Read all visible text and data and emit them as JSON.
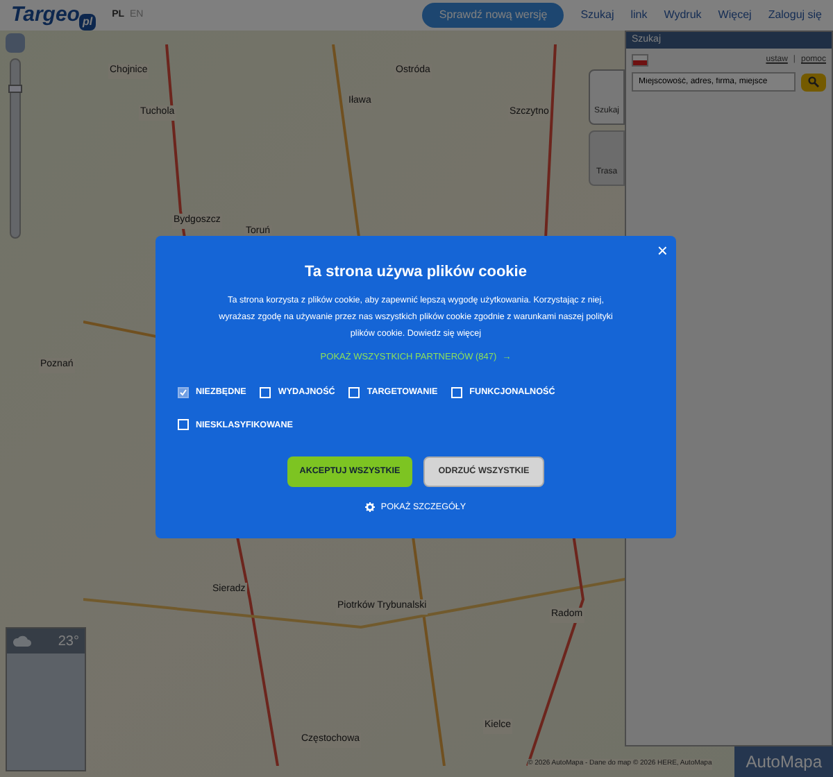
{
  "header": {
    "logo": "Targeo",
    "logo_suffix": "pl",
    "languages": [
      {
        "code": "PL",
        "selected": true
      },
      {
        "code": "EN",
        "selected": false
      }
    ],
    "new_version_button": "Sprawdź nową wersję",
    "nav": [
      "Szukaj",
      "link",
      "Wydruk",
      "Więcej",
      "Zaloguj się"
    ]
  },
  "map": {
    "cities": [
      {
        "name": "Chojnice"
      },
      {
        "name": "Tuchola"
      },
      {
        "name": "Iława"
      },
      {
        "name": "Ostróda"
      },
      {
        "name": "Szczytno"
      },
      {
        "name": "Bydgoszcz"
      },
      {
        "name": "Toruń"
      },
      {
        "name": "Poznań"
      },
      {
        "name": "Sieradz"
      },
      {
        "name": "Piotrków Trybunalski"
      },
      {
        "name": "Radom"
      },
      {
        "name": "Częstochowa"
      },
      {
        "name": "Kielce"
      }
    ],
    "zoom": {
      "level": 0.85
    },
    "attribution": "© 2026 AutoMapa - Dane do map © 2026 HERE, AutoMapa",
    "brand": "AutoMapa"
  },
  "weather": {
    "temperature": "23°"
  },
  "search_panel": {
    "title": "Szukaj",
    "links": [
      "ustaw",
      "pomoc"
    ],
    "link_separator": "|",
    "search_value": "Miejscowość, adres, firma, miejsce",
    "tabs": [
      {
        "label": "Szukaj",
        "selected": true
      },
      {
        "label": "Trasa",
        "selected": false
      }
    ]
  },
  "cookie_dialog": {
    "title": "Ta strona używa plików cookie",
    "text": "Ta strona korzysta z plików cookie, aby zapewnić lepszą wygodę użytkowania. Korzystając z niej, wyrażasz zgodę na używanie przez nas wszystkich plików cookie zgodnie z warunkami naszej polityki plików cookie.",
    "more_link": "Dowiedz się więcej",
    "partners_link": "POKAŻ WSZYSTKICH PARTNERÓW (847)",
    "partners_arrow": "→",
    "categories": [
      {
        "label": "NIEZBĘDNE",
        "checked": true,
        "disabled": true
      },
      {
        "label": "WYDAJNOŚĆ",
        "checked": false,
        "disabled": false
      },
      {
        "label": "TARGETOWANIE",
        "checked": false,
        "disabled": false
      },
      {
        "label": "FUNKCJONALNOŚĆ",
        "checked": false,
        "disabled": false
      },
      {
        "label": "NIESKLASYFIKOWANE",
        "checked": false,
        "disabled": false
      }
    ],
    "accept_button": "AKCEPTUJ WSZYSTKIE",
    "reject_button": "ODRZUĆ WSZYSTKIE",
    "details_link": "POKAŻ SZCZEGÓŁY",
    "close": "×"
  }
}
